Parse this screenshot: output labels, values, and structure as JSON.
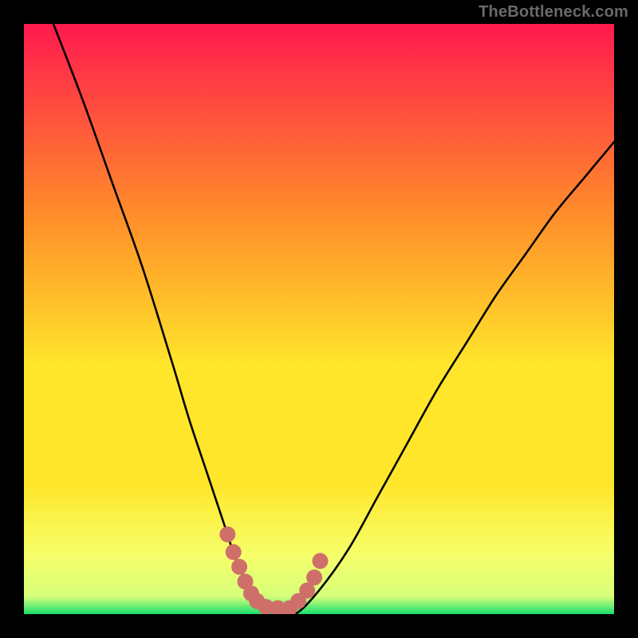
{
  "watermark": "TheBottleneck.com",
  "colors": {
    "frame": "#000000",
    "gradient_top": "#ff1a4f",
    "gradient_mid1": "#ff8c2a",
    "gradient_mid2": "#ffe62b",
    "gradient_low": "#f6ff6a",
    "gradient_band": "#d7ff7a",
    "gradient_bottom": "#19e06e",
    "curve": "#000000",
    "marker": "#cf6f6a"
  },
  "chart_data": {
    "type": "line",
    "title": "",
    "xlabel": "",
    "ylabel": "",
    "xlim": [
      0,
      100
    ],
    "ylim": [
      0,
      100
    ],
    "series": [
      {
        "name": "bottleneck-curve",
        "x": [
          5,
          10,
          15,
          20,
          25,
          28,
          31,
          34,
          36,
          38,
          40,
          43,
          46,
          50,
          55,
          60,
          65,
          70,
          75,
          80,
          85,
          90,
          95,
          100
        ],
        "y": [
          100,
          87,
          73,
          59,
          43,
          33,
          24,
          15,
          9,
          5,
          2,
          0,
          0,
          4,
          11,
          20,
          29,
          38,
          46,
          54,
          61,
          68,
          74,
          80
        ]
      }
    ],
    "optimal_range_x": [
      36,
      50
    ],
    "markers": {
      "name": "optimal-band-marks",
      "x": [
        34.5,
        35.5,
        36.5,
        37.5,
        38.5,
        39.5,
        41.0,
        43.0,
        45.0,
        46.5,
        48.0,
        49.2,
        50.2
      ],
      "y": [
        13.5,
        10.5,
        8.0,
        5.5,
        3.5,
        2.2,
        1.2,
        1.0,
        1.0,
        2.2,
        4.0,
        6.2,
        9.0
      ]
    }
  }
}
